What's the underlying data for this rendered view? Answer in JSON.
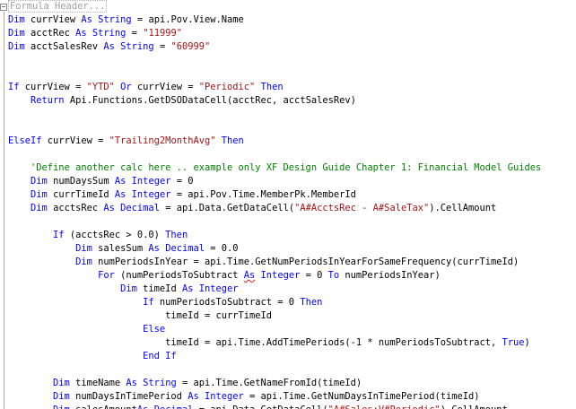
{
  "editor": {
    "header_placeholder": "Formula Header...",
    "lines": [
      [
        {
          "t": "Dim",
          "c": "kw"
        },
        {
          "t": " currView "
        },
        {
          "t": "As",
          "c": "kw"
        },
        {
          "t": " "
        },
        {
          "t": "String",
          "c": "kw"
        },
        {
          "t": " = api.Pov.View.Name"
        }
      ],
      [
        {
          "t": "Dim",
          "c": "kw"
        },
        {
          "t": " acctRec "
        },
        {
          "t": "As",
          "c": "kw"
        },
        {
          "t": " "
        },
        {
          "t": "String",
          "c": "kw"
        },
        {
          "t": " = "
        },
        {
          "t": "\"11999\"",
          "c": "str"
        }
      ],
      [
        {
          "t": "Dim",
          "c": "kw"
        },
        {
          "t": " acctSalesRev "
        },
        {
          "t": "As",
          "c": "kw"
        },
        {
          "t": " "
        },
        {
          "t": "String",
          "c": "kw"
        },
        {
          "t": " = "
        },
        {
          "t": "\"60999\"",
          "c": "str"
        }
      ],
      [],
      [],
      [
        {
          "t": "If",
          "c": "kw"
        },
        {
          "t": " currView = "
        },
        {
          "t": "\"YTD\"",
          "c": "str"
        },
        {
          "t": " "
        },
        {
          "t": "Or",
          "c": "kw"
        },
        {
          "t": " currView = "
        },
        {
          "t": "\"Periodic\"",
          "c": "str"
        },
        {
          "t": " "
        },
        {
          "t": "Then",
          "c": "kw"
        }
      ],
      [
        {
          "t": "    "
        },
        {
          "t": "Return",
          "c": "kw"
        },
        {
          "t": " Api.Functions.GetDSODataCell(acctRec, acctSalesRev)"
        }
      ],
      [],
      [],
      [
        {
          "t": "ElseIf",
          "c": "kw"
        },
        {
          "t": " currView = "
        },
        {
          "t": "\"Trailing2MonthAvg\"",
          "c": "str"
        },
        {
          "t": " "
        },
        {
          "t": "Then",
          "c": "kw"
        }
      ],
      [],
      [
        {
          "t": "    "
        },
        {
          "t": "'Define another calc here .. example only XF Design Guide Chapter 1: Financial Model Guides",
          "c": "cmt"
        }
      ],
      [
        {
          "t": "    "
        },
        {
          "t": "Dim",
          "c": "kw"
        },
        {
          "t": " numDaysSum "
        },
        {
          "t": "As",
          "c": "kw"
        },
        {
          "t": " "
        },
        {
          "t": "Integer",
          "c": "kw"
        },
        {
          "t": " = 0"
        }
      ],
      [
        {
          "t": "    "
        },
        {
          "t": "Dim",
          "c": "kw"
        },
        {
          "t": " currTimeId "
        },
        {
          "t": "As",
          "c": "kw"
        },
        {
          "t": " "
        },
        {
          "t": "Integer",
          "c": "kw"
        },
        {
          "t": " = api.Pov.Time.MemberPk.MemberId"
        }
      ],
      [
        {
          "t": "    "
        },
        {
          "t": "Dim",
          "c": "kw"
        },
        {
          "t": " acctsRec "
        },
        {
          "t": "As",
          "c": "kw"
        },
        {
          "t": " "
        },
        {
          "t": "Decimal",
          "c": "kw"
        },
        {
          "t": " = api.Data.GetDataCell("
        },
        {
          "t": "\"A#AcctsRec - A#SaleTax\"",
          "c": "str"
        },
        {
          "t": ").CellAmount"
        }
      ],
      [],
      [
        {
          "t": "        "
        },
        {
          "t": "If",
          "c": "kw"
        },
        {
          "t": " (acctsRec > 0.0) "
        },
        {
          "t": "Then",
          "c": "kw"
        }
      ],
      [
        {
          "t": "            "
        },
        {
          "t": "Dim",
          "c": "kw"
        },
        {
          "t": " salesSum "
        },
        {
          "t": "As",
          "c": "kw"
        },
        {
          "t": " "
        },
        {
          "t": "Decimal",
          "c": "kw"
        },
        {
          "t": " = 0.0"
        }
      ],
      [
        {
          "t": "            "
        },
        {
          "t": "Dim",
          "c": "kw"
        },
        {
          "t": " numPeriodsInYear = api.Time.GetNumPeriodsInYearForSameFrequency(currTimeId)"
        }
      ],
      [
        {
          "t": "                "
        },
        {
          "t": "For",
          "c": "kw"
        },
        {
          "t": " (numPeriodsToSubtract "
        },
        {
          "t": "As",
          "c": "kw",
          "u": true
        },
        {
          "t": " "
        },
        {
          "t": "Integer",
          "c": "kw"
        },
        {
          "t": " = 0 "
        },
        {
          "t": "To",
          "c": "kw"
        },
        {
          "t": " numPeriodsInYear)"
        }
      ],
      [
        {
          "t": "                    "
        },
        {
          "t": "Dim",
          "c": "kw"
        },
        {
          "t": " timeId "
        },
        {
          "t": "As",
          "c": "kw"
        },
        {
          "t": " "
        },
        {
          "t": "Integer",
          "c": "kw"
        }
      ],
      [
        {
          "t": "                        "
        },
        {
          "t": "If",
          "c": "kw"
        },
        {
          "t": " numPeriodsToSubtract = 0 "
        },
        {
          "t": "Then",
          "c": "kw"
        }
      ],
      [
        {
          "t": "                            timeId = currTimeId"
        }
      ],
      [
        {
          "t": "                        "
        },
        {
          "t": "Else",
          "c": "kw"
        }
      ],
      [
        {
          "t": "                            timeId = api.Time.AddTimePeriods(-1 * numPeriodsToSubtract, "
        },
        {
          "t": "True",
          "c": "kw"
        },
        {
          "t": ")"
        }
      ],
      [
        {
          "t": "                        "
        },
        {
          "t": "End If",
          "c": "kw"
        }
      ],
      [],
      [
        {
          "t": "        "
        },
        {
          "t": "Dim",
          "c": "kw"
        },
        {
          "t": " timeName "
        },
        {
          "t": "As",
          "c": "kw"
        },
        {
          "t": " "
        },
        {
          "t": "String",
          "c": "kw"
        },
        {
          "t": " = api.Time.GetNameFromId(timeId)"
        }
      ],
      [
        {
          "t": "        "
        },
        {
          "t": "Dim",
          "c": "kw"
        },
        {
          "t": " numDaysInTimePeriod "
        },
        {
          "t": "As",
          "c": "kw"
        },
        {
          "t": " "
        },
        {
          "t": "Integer",
          "c": "kw"
        },
        {
          "t": " = api.Time.GetNumDaysInTimePeriod(timeId)"
        }
      ],
      [
        {
          "t": "        "
        },
        {
          "t": "Dim",
          "c": "kw"
        },
        {
          "t": " salesAmount"
        },
        {
          "t": "As",
          "c": "kw"
        },
        {
          "t": " "
        },
        {
          "t": "Decimal",
          "c": "kw"
        },
        {
          "t": " = api.Data.GetDataCell("
        },
        {
          "t": "\"A#Sales:V#Periodic\"",
          "c": "str"
        },
        {
          "t": ").CellAmount"
        }
      ]
    ]
  }
}
